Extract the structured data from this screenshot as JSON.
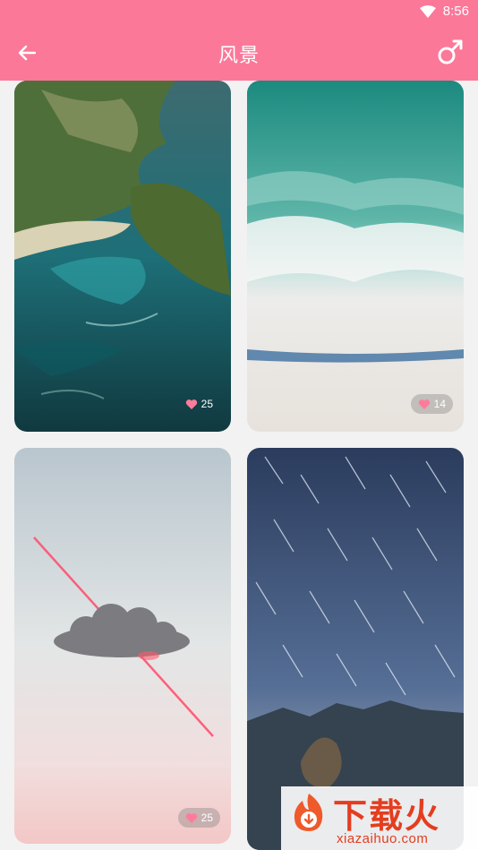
{
  "status": {
    "time": "8:56",
    "wifi_icon": "wifi-icon"
  },
  "header": {
    "title": "风景",
    "back_icon": "back-arrow-icon",
    "gender_icon": "male-icon",
    "bg_color": "#fb7899"
  },
  "cards": [
    {
      "likes": "25",
      "scene": "coastal-cliffs-aerial"
    },
    {
      "likes": "14",
      "scene": "beach-waves-aerial"
    },
    {
      "likes": "25",
      "scene": "cloud-with-laser"
    },
    {
      "likes": "",
      "scene": "star-trails-mountains"
    }
  ],
  "watermark": {
    "brand": "下载火",
    "url": "xiazaihuo.com"
  }
}
